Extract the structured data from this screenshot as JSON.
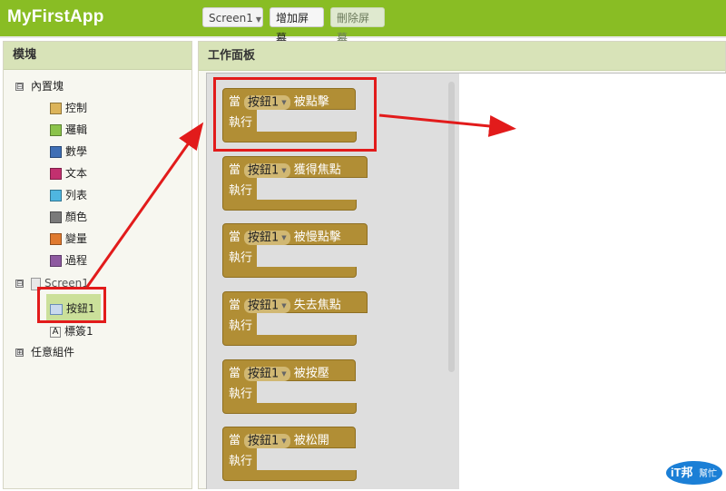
{
  "app": {
    "title": "MyFirstApp"
  },
  "toolbar": {
    "screen_select": "Screen1",
    "add_screen": "增加屏幕",
    "remove_screen": "刪除屏幕"
  },
  "left_panel": {
    "title": "模塊",
    "builtin": {
      "label": "內置塊",
      "toggle": "⊟",
      "items": [
        {
          "label": "控制",
          "color": "#dcb45a"
        },
        {
          "label": "邏輯",
          "color": "#8bc34a"
        },
        {
          "label": "數學",
          "color": "#3f6fb5"
        },
        {
          "label": "文本",
          "color": "#c2306f"
        },
        {
          "label": "列表",
          "color": "#4fb6e0"
        },
        {
          "label": "顏色",
          "color": "#7a7a7a"
        },
        {
          "label": "變量",
          "color": "#e07a2f"
        },
        {
          "label": "過程",
          "color": "#8e5aa0"
        }
      ]
    },
    "screen": {
      "label": "Screen1",
      "toggle": "⊟",
      "children": [
        {
          "label": "按鈕1",
          "icon": "button-icon"
        },
        {
          "label": "標簽1",
          "icon": "label-icon"
        }
      ]
    },
    "any_component": {
      "label": "任意組件",
      "toggle": "⊞"
    }
  },
  "workspace": {
    "title": "工作面板",
    "blocks": [
      {
        "when": "當",
        "component": "按鈕1",
        "event": "被點擊",
        "do": "執行"
      },
      {
        "when": "當",
        "component": "按鈕1",
        "event": "獲得焦點",
        "do": "執行"
      },
      {
        "when": "當",
        "component": "按鈕1",
        "event": "被慢點擊",
        "do": "執行"
      },
      {
        "when": "當",
        "component": "按鈕1",
        "event": "失去焦點",
        "do": "執行"
      },
      {
        "when": "當",
        "component": "按鈕1",
        "event": "被按壓",
        "do": "執行"
      },
      {
        "when": "當",
        "component": "按鈕1",
        "event": "被松開",
        "do": "執行"
      }
    ]
  },
  "watermark": {
    "line1": "iT邦",
    "line2": "幫忙"
  },
  "colors": {
    "topbar": "#89bd24",
    "block": "#b18e35",
    "highlight": "#e21b1b"
  }
}
